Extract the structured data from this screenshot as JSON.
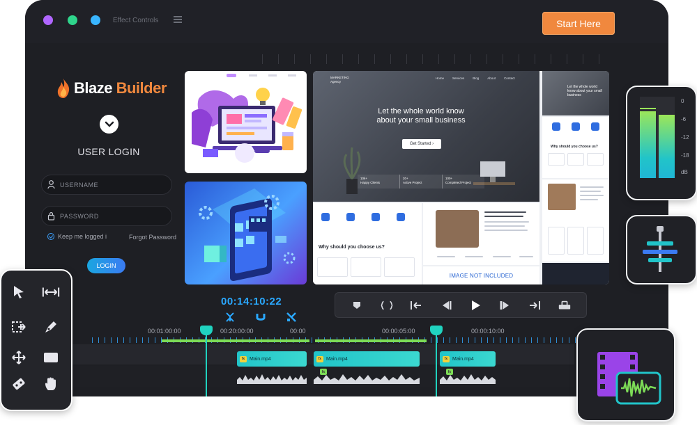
{
  "window": {
    "title": "Effect Controls",
    "start_button": "Start Here",
    "dot_colors": [
      "#b066ff",
      "#2fd58c",
      "#39b5ff"
    ]
  },
  "login": {
    "brand_word1": "Blaze",
    "brand_word2": "Builder",
    "heading": "USER LOGIN",
    "username_placeholder": "USERNAME",
    "password_placeholder": "PASSWORD",
    "remember": "Keep me logged i",
    "forgot": "Forgot Password",
    "button": "LOGIN"
  },
  "preview": {
    "agency": "MARKETING\nAgency",
    "nav": [
      "Home",
      "Services",
      "Blog",
      "About",
      "Contact"
    ],
    "headline": "Let the whole world know about your small business",
    "cta": "Get Started",
    "stats": [
      {
        "value": "10k+",
        "label": "Happy Clients"
      },
      {
        "value": "20+",
        "label": "Active Project"
      },
      {
        "value": "100+",
        "label": "Completed Project"
      }
    ],
    "why_heading": "Why should you choose us?",
    "right_headline": "Let the whole world know about your small business",
    "not_included": "IMAGE NOT INCLUDED"
  },
  "editor": {
    "timecode": "00:14:10:22",
    "timeline_labels": [
      "00:01:00:00",
      "00:20:00:00",
      "00:00",
      "00:00:05:00",
      "00:00:10:00"
    ],
    "clips": [
      {
        "label": "Main.mp4",
        "fx": "fx"
      },
      {
        "label": "Main.mp4",
        "fx": "fx"
      },
      {
        "label": "Main.mp4",
        "fx": "fx"
      }
    ]
  },
  "meter": {
    "scale": [
      "0",
      "-6",
      "-12",
      "-18",
      "dB"
    ],
    "levels": [
      0.82,
      0.77
    ]
  },
  "colors": {
    "accent_orange": "#f0883e",
    "timecode_blue": "#2aa8ff",
    "clip_teal": "#21c4c9",
    "playhead": "#20d3c0"
  }
}
